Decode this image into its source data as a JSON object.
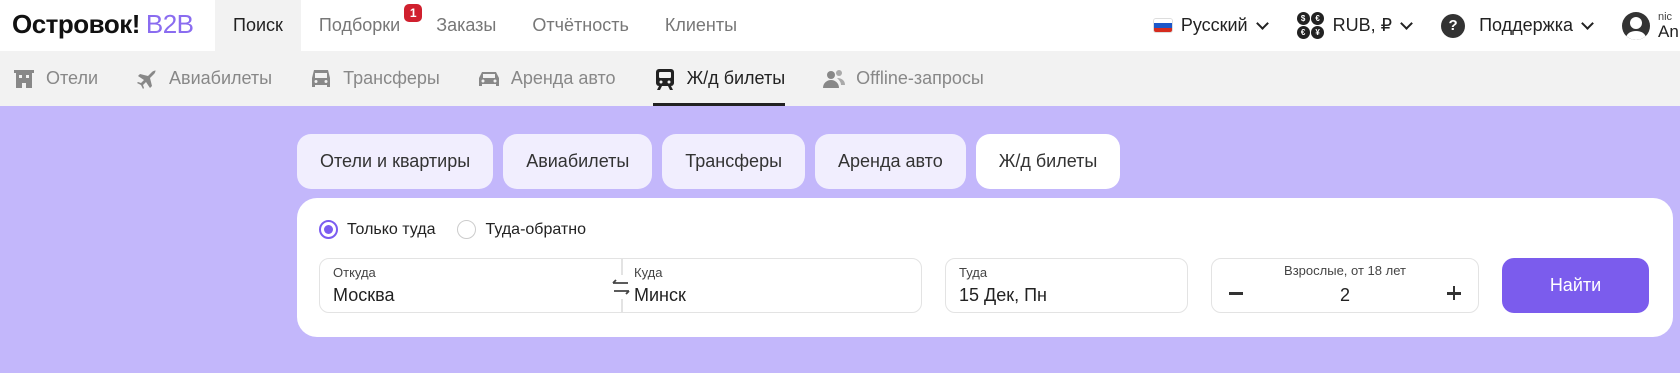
{
  "logo": {
    "main": "Островок!",
    "suffix": "B2B"
  },
  "topnav": {
    "items": [
      {
        "label": "Поиск",
        "active": true
      },
      {
        "label": "Подборки",
        "badge": "1"
      },
      {
        "label": "Заказы"
      },
      {
        "label": "Отчётность"
      },
      {
        "label": "Клиенты"
      }
    ]
  },
  "top_right": {
    "language": "Русский",
    "currency": "RUB, ₽",
    "support": "Поддержка",
    "user_line1": "nic",
    "user_line2": "An"
  },
  "subnav": {
    "items": [
      {
        "label": "Отели",
        "icon": "hotel-icon"
      },
      {
        "label": "Авиабилеты",
        "icon": "plane-icon"
      },
      {
        "label": "Трансферы",
        "icon": "car-icon"
      },
      {
        "label": "Аренда авто",
        "icon": "car-rental-icon"
      },
      {
        "label": "Ж/д билеты",
        "icon": "train-icon",
        "active": true
      },
      {
        "label": "Offline-запросы",
        "icon": "users-icon"
      }
    ]
  },
  "search_tabs": [
    {
      "label": "Отели и квартиры"
    },
    {
      "label": "Авиабилеты"
    },
    {
      "label": "Трансферы"
    },
    {
      "label": "Аренда авто"
    },
    {
      "label": "Ж/д билеты",
      "active": true
    }
  ],
  "search": {
    "trip_one_way": "Только туда",
    "trip_round": "Туда-обратно",
    "from_label": "Откуда",
    "from_value": "Москва",
    "to_label": "Куда",
    "to_value": "Минск",
    "date_label": "Туда",
    "date_value": "15 Дек, Пн",
    "pax_label": "Взрослые, от 18 лет",
    "pax_value": "2",
    "find_button": "Найти"
  },
  "colors": {
    "accent": "#7b5ced",
    "background": "#c3b7fb",
    "badge": "#d0202e"
  }
}
